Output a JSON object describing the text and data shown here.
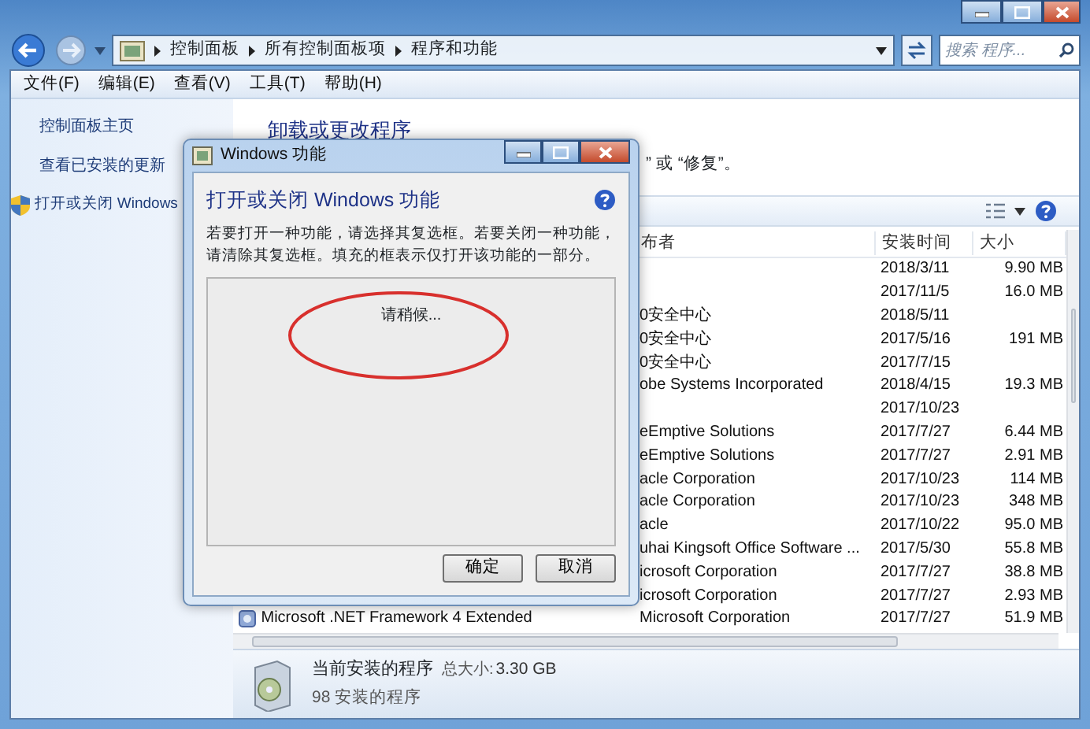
{
  "address_bar": {
    "breadcrumbs": [
      "控制面板",
      "所有控制面板项",
      "程序和功能"
    ],
    "search_placeholder": "搜索 程序..."
  },
  "menu": [
    "文件(F)",
    "编辑(E)",
    "查看(V)",
    "工具(T)",
    "帮助(H)"
  ],
  "sidebar": {
    "items": [
      {
        "label": "控制面板主页",
        "kind": "link"
      },
      {
        "label": "查看已安装的更新",
        "kind": "link"
      },
      {
        "label": "打开或关闭 Windows",
        "kind": "shield-link"
      }
    ]
  },
  "main": {
    "title": "卸载或更改程序",
    "subtitle": "” 或 “修复”。"
  },
  "table": {
    "columns": [
      "",
      "布者",
      "安装时间",
      "大小"
    ],
    "rows": [
      {
        "name": "",
        "publisher": "",
        "installed": "2018/3/11",
        "size": "9.90 MB"
      },
      {
        "name": "",
        "publisher": "",
        "installed": "2017/11/5",
        "size": "16.0 MB"
      },
      {
        "name": "",
        "publisher": "0安全中心",
        "installed": "2018/5/11",
        "size": ""
      },
      {
        "name": "",
        "publisher": "0安全中心",
        "installed": "2017/5/16",
        "size": "191 MB"
      },
      {
        "name": "",
        "publisher": "0安全中心",
        "installed": "2017/7/15",
        "size": ""
      },
      {
        "name": "",
        "publisher": "obe Systems Incorporated",
        "installed": "2018/4/15",
        "size": "19.3 MB"
      },
      {
        "name": "",
        "publisher": "",
        "installed": "2017/10/23",
        "size": ""
      },
      {
        "name": "",
        "publisher": "eEmptive Solutions",
        "installed": "2017/7/27",
        "size": "6.44 MB"
      },
      {
        "name": "",
        "publisher": "eEmptive Solutions",
        "installed": "2017/7/27",
        "size": "2.91 MB"
      },
      {
        "name": "",
        "publisher": "acle Corporation",
        "installed": "2017/10/23",
        "size": "114 MB"
      },
      {
        "name": "",
        "publisher": "acle Corporation",
        "installed": "2017/10/23",
        "size": "348 MB"
      },
      {
        "name": "",
        "publisher": "acle",
        "installed": "2017/10/22",
        "size": "95.0 MB"
      },
      {
        "name": "",
        "publisher": "uhai Kingsoft Office Software ...",
        "installed": "2017/5/30",
        "size": "55.8 MB"
      },
      {
        "name": "",
        "publisher": "icrosoft Corporation",
        "installed": "2017/7/27",
        "size": "38.8 MB"
      },
      {
        "name": "",
        "publisher": "icrosoft Corporation",
        "installed": "2017/7/27",
        "size": "2.93 MB"
      },
      {
        "name": "Microsoft .NET Framework 4 Extended",
        "publisher": "Microsoft Corporation",
        "installed": "2017/7/27",
        "size": "51.9 MB"
      }
    ]
  },
  "status": {
    "title": "当前安装的程序",
    "total_label": "总大小:",
    "total": "3.30 GB",
    "count": "98 安装的程序"
  },
  "dialog": {
    "title": "Windows 功能",
    "heading": "打开或关闭 Windows 功能",
    "description": "若要打开一种功能，请选择其复选框。若要关闭一种功能，请清除其复选框。填充的框表示仅打开该功能的一部分。",
    "status": "请稍候...",
    "buttons": [
      "确定",
      "取消"
    ]
  }
}
